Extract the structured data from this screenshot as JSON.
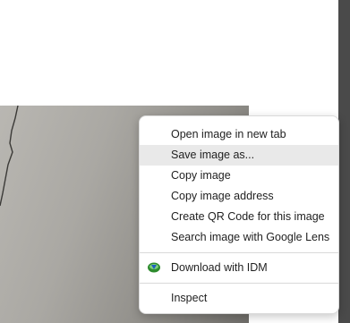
{
  "context_menu": {
    "items": [
      {
        "label": "Open image in new tab"
      },
      {
        "label": "Save image as..."
      },
      {
        "label": "Copy image"
      },
      {
        "label": "Copy image address"
      },
      {
        "label": "Create QR Code for this image"
      },
      {
        "label": "Search image with Google Lens"
      },
      {
        "label": "Download with IDM",
        "icon": "idm-icon"
      },
      {
        "label": "Inspect"
      }
    ],
    "highlighted_item": "Save image as..."
  }
}
